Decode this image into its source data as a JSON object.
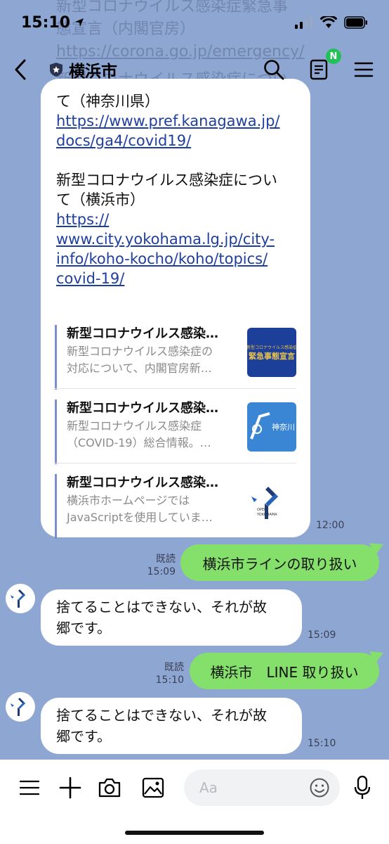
{
  "status_bar": {
    "time": "15:10",
    "location_icon": "location-arrow-icon"
  },
  "ghost": {
    "line1": "新型コロナウイルス感染症緊急事",
    "line2": "態宣言（内閣官房）",
    "line3": "https://corona.go.jp/emergency/",
    "line4": "新型コロナウイルス感染症につい"
  },
  "header": {
    "title": "横浜市",
    "badge": "N"
  },
  "main_message": {
    "line1": "て（神奈川県）",
    "link1a": "https://www.pref.kanagawa.jp/",
    "link1b": "docs/ga4/covid19/",
    "text2a": "新型コロナウイルス感染症につい",
    "text2b": "て（横浜市）",
    "link2a": "https://",
    "link2b": "www.city.yokohama.lg.jp/city-",
    "link2c": "info/koho-kocho/koho/topics/",
    "link2d": "covid-19/",
    "previews": [
      {
        "title": "新型コロナウイルス感染…",
        "desc1": "新型コロナウイルス感染症の",
        "desc2": "対応について、内閣官房新…",
        "thumb_text1": "新型コロナウイルス感染症",
        "thumb_text2": "緊急事態宣言"
      },
      {
        "title": "新型コロナウイルス感染…",
        "desc1": "新型コロナウイルス感染症",
        "desc2": "（COVID-19）総合情報。…",
        "thumb_text1": "神奈川"
      },
      {
        "title": "新型コロナウイルス感染…",
        "desc1": "横浜市ホームページでは",
        "desc2": "JavaScriptを使用していま…",
        "thumb_text1": "OPEN",
        "thumb_text2": "YOKOHAMA"
      }
    ],
    "time": "12:00"
  },
  "messages": [
    {
      "read": "既読",
      "time": "15:09",
      "text": "横浜市ラインの取り扱い"
    },
    {
      "line1": "捨てることはできない、それが故",
      "line2": "郷です。",
      "time": "15:09"
    },
    {
      "read": "既読",
      "time": "15:10",
      "text": "横浜市　LINE 取り扱い"
    },
    {
      "line1": "捨てることはできない、それが故",
      "line2": "郷です。",
      "time": "15:10"
    }
  ],
  "avatar": {
    "line1": "OPEN",
    "line2": "YOKOHAMA"
  },
  "input": {
    "placeholder": "Aa"
  },
  "colors": {
    "background": "#8ea7d2",
    "bubble_out": "#84e06a",
    "link": "#1f3fa0",
    "badge": "#21c157"
  }
}
